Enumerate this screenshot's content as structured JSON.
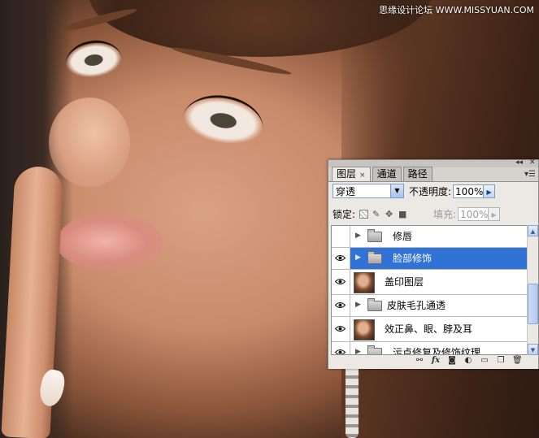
{
  "watermark": "思缘设计论坛 WWW.MISSYUAN.COM",
  "panel": {
    "tabs": [
      {
        "label": "图层",
        "close": "×"
      },
      {
        "label": "通道"
      },
      {
        "label": "路径"
      }
    ],
    "blend_mode": "穿透",
    "opacity_label": "不透明度:",
    "opacity_value": "100%",
    "lock_label": "锁定:",
    "fill_label": "填充:",
    "fill_value": "100%",
    "layers": [
      {
        "name": "修唇",
        "type": "group",
        "visible": false,
        "selected": false
      },
      {
        "name": "脸部修饰",
        "type": "group",
        "visible": true,
        "selected": true
      },
      {
        "name": "盖印图层",
        "type": "pixel",
        "visible": true,
        "selected": false
      },
      {
        "name": "皮肤毛孔通透",
        "type": "group",
        "visible": true,
        "selected": false
      },
      {
        "name": "效正鼻、眼、脖及耳",
        "type": "pixel",
        "visible": true,
        "selected": false
      },
      {
        "name": "污点修复及修饰纹理",
        "type": "group",
        "visible": true,
        "selected": false
      }
    ],
    "bottom_icons": [
      "link-icon",
      "fx-icon",
      "mask-icon",
      "adjustment-icon",
      "new-group-icon",
      "new-layer-icon",
      "trash-icon"
    ],
    "bottom_fx": "fx"
  },
  "colors": {
    "selected_row": "#3072d6",
    "panel_bg": "#ece9e4"
  }
}
